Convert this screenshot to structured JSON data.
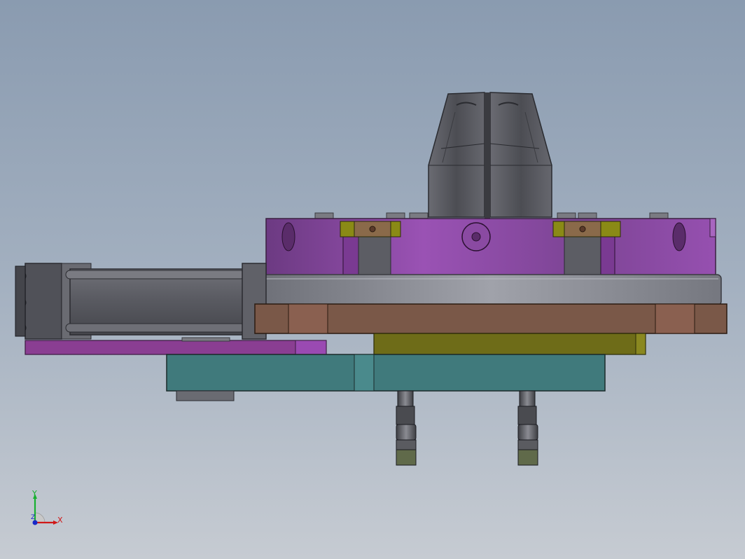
{
  "viewport": {
    "background_top": "#8a9bb0",
    "background_bottom": "#c6cbd2"
  },
  "model": {
    "icon": "cad-assembly-model",
    "colors": {
      "purple_flange": "#8e4aa8",
      "gray_ring": "#8a8c94",
      "brown_plate": "#7a5848",
      "olive_plate": "#6e6c18",
      "teal_base": "#407a7c",
      "cylinder_gray": "#5e5f66",
      "collet_dark": "#55565c"
    }
  },
  "triad": {
    "icon": "coordinate-triad-icon",
    "x_label": "X",
    "y_label": "Y",
    "x_color": "#d01818",
    "y_color": "#18b030",
    "z_color": "#1828c8"
  }
}
